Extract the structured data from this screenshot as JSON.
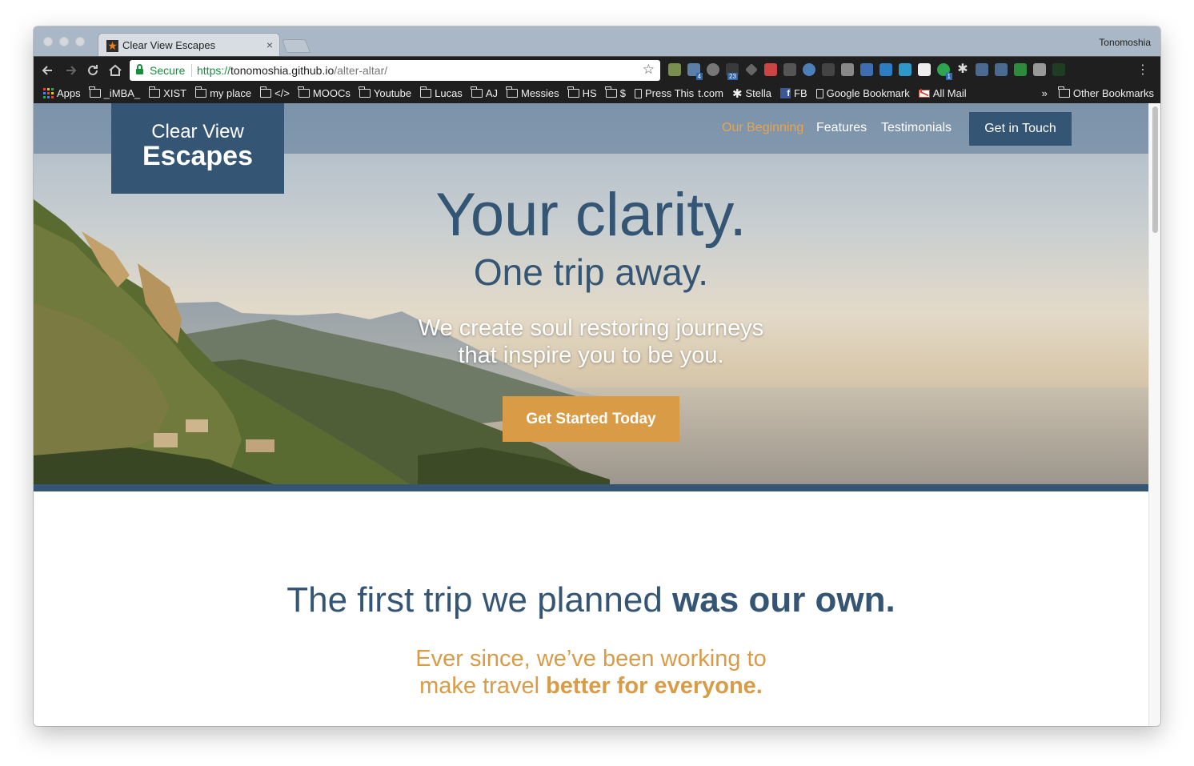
{
  "browser": {
    "tab_title": "Clear View Escapes",
    "tab_close": "×",
    "profile_name": "Tonomoshia",
    "secure_label": "Secure",
    "url_scheme": "https://",
    "url_host": "tonomoshia.github.io",
    "url_path": "/alter-altar/",
    "bookmarks": [
      "Apps",
      "_iMBA_",
      "XIST",
      "my place",
      "</>",
      "MOOCs",
      "Youtube",
      "Lucas",
      "AJ",
      "Messies",
      "HS",
      "$",
      "Press This",
      "t.com",
      "Stella",
      "FB",
      "Google Bookmark",
      "All Mail"
    ],
    "bookmarks_overflow": "»",
    "other_bookmarks": "Other Bookmarks",
    "extension_badges": [
      "4",
      "23",
      "1"
    ]
  },
  "site": {
    "logo_line1": "Clear View",
    "logo_line2": "Escapes",
    "nav": [
      "Our Beginning",
      "Features",
      "Testimonials"
    ],
    "nav_cta": "Get in Touch",
    "hero": {
      "headline": "Your clarity.",
      "subheadline": "One trip away.",
      "tagline_line1": "We create soul restoring journeys",
      "tagline_line2": "that inspire you to be you.",
      "cta": "Get Started Today"
    },
    "section": {
      "title_light": "The first trip we planned ",
      "title_bold": "was our own.",
      "sub_line1": "Ever since, we’ve been working to",
      "sub_line2_light": "make travel ",
      "sub_line2_bold": "better for everyone."
    }
  },
  "colors": {
    "brand_blue": "#345574",
    "accent_gold": "#d99b45",
    "nav_active": "#e8a44a"
  }
}
